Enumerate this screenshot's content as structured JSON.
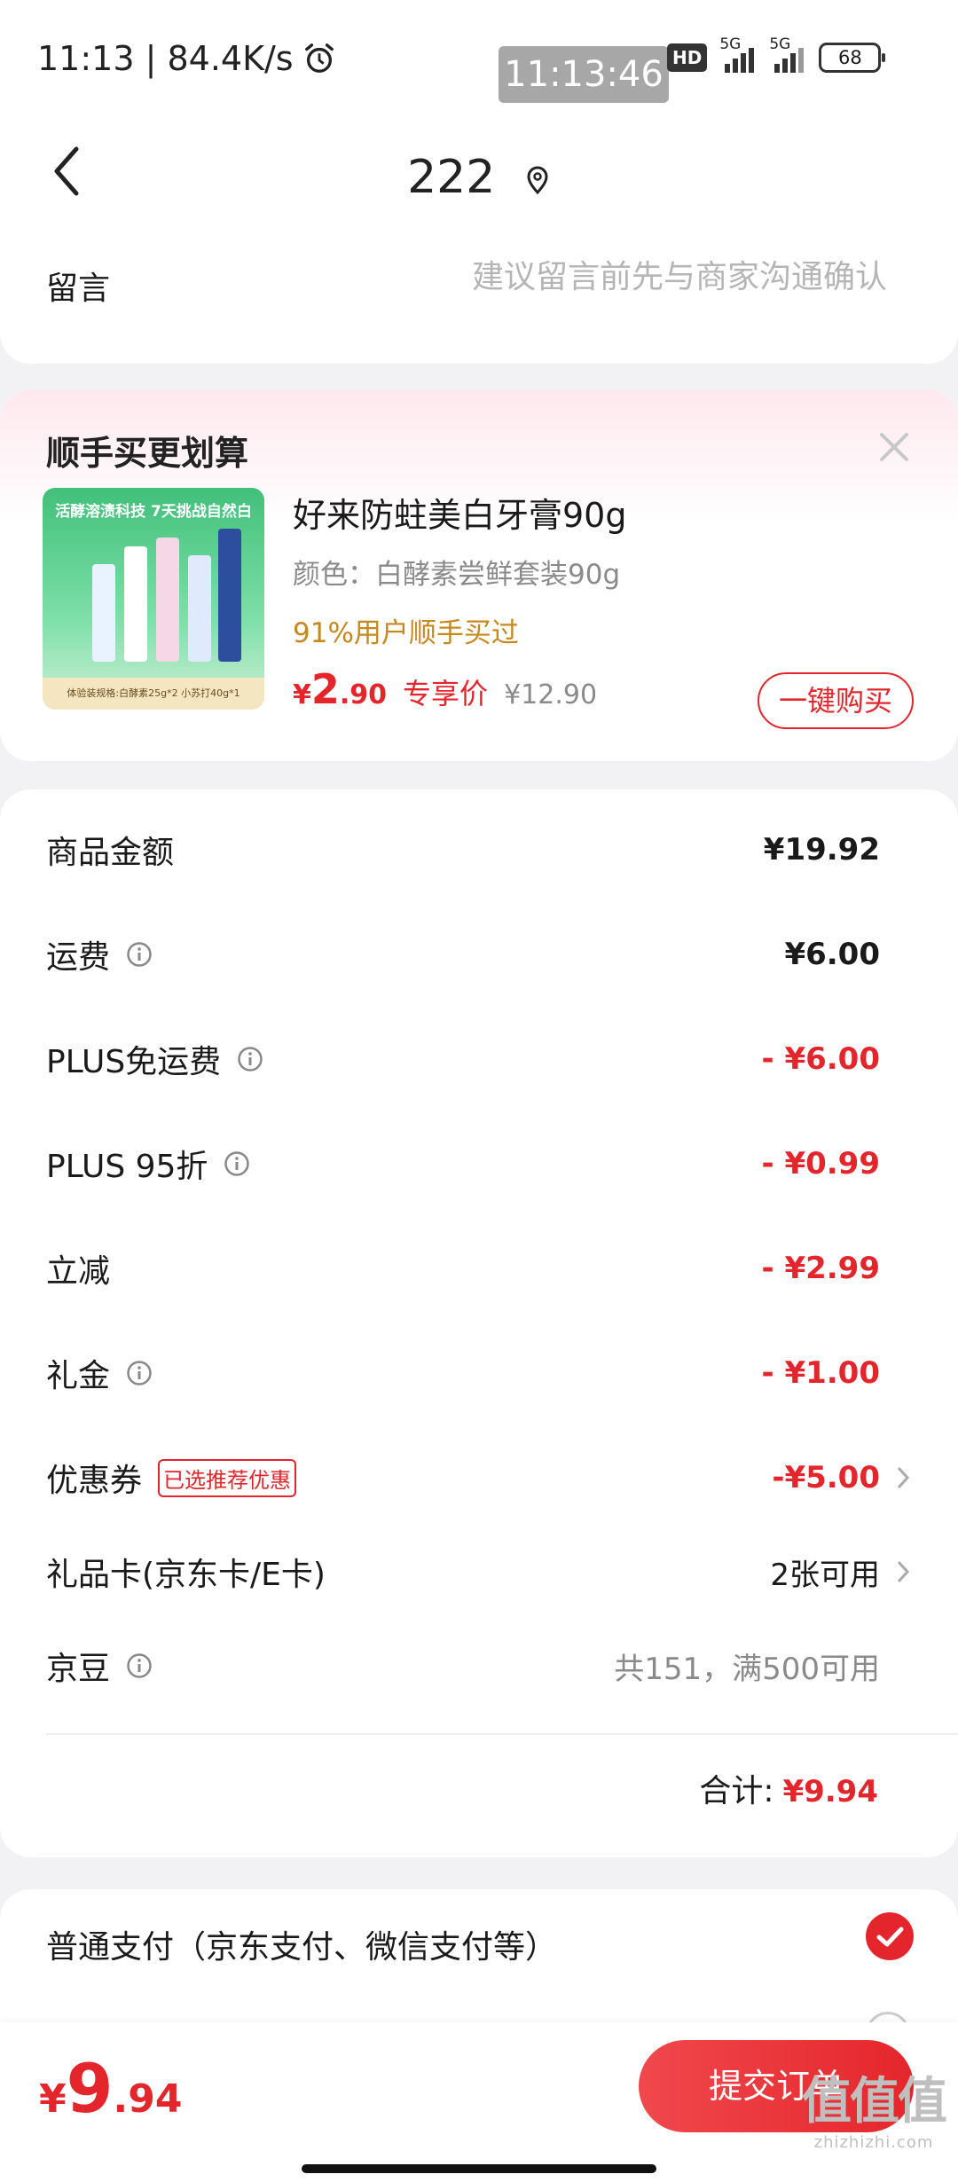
{
  "status_bar": {
    "left_text": "11:13 | 84.4K/s",
    "time_chip": "11:13:46",
    "hd_label": "HD",
    "net1": "5G",
    "net2": "5G",
    "battery": "68"
  },
  "header": {
    "title": "222"
  },
  "message": {
    "label": "留言",
    "placeholder": "建议留言前先与商家沟通确认"
  },
  "promo": {
    "title": "顺手买更划算",
    "image_banner": "活酵溶渍科技 7天挑战自然白",
    "image_footer": "体验装规格:白酵素25g*2 小苏打40g*1",
    "product_name": "好来防蛀美白牙膏90g",
    "spec": "颜色：白酵素尝鲜套装90g",
    "tag": "91%用户顺手买过",
    "price_currency": "¥",
    "price_int": "2",
    "price_dec": ".90",
    "price_label": "专享价",
    "orig_price": "¥12.90",
    "buy_label": "一键购买"
  },
  "summary": {
    "rows": [
      {
        "label": "商品金额",
        "value": "¥19.92"
      },
      {
        "label": "运费",
        "value": "¥6.00"
      },
      {
        "label": "PLUS免运费",
        "value": "- ¥6.00"
      },
      {
        "label": "PLUS 95折",
        "value": "- ¥0.99"
      },
      {
        "label": "立减",
        "value": "- ¥2.99"
      },
      {
        "label": "礼金",
        "value": "- ¥1.00"
      },
      {
        "label": "优惠券",
        "badge": "已选推荐优惠",
        "value": "-¥5.00"
      },
      {
        "label": "礼品卡(京东卡/E卡)",
        "value": "2张可用"
      },
      {
        "label": "京豆",
        "value": "共151，满500可用"
      }
    ],
    "total_label": "合计:",
    "total_value": "¥9.94"
  },
  "payment": {
    "label": "普通支付（京东支付、微信支付等）"
  },
  "bottom": {
    "price_currency": "¥",
    "price_int": "9",
    "price_dec": ".94",
    "submit_label": "提交订单"
  },
  "watermark": {
    "line1": "值值值",
    "line2": "zhizhizhi.com"
  },
  "colors": {
    "accent": "#e4262c",
    "tag": "#c8881c",
    "background": "#f2f2f4"
  }
}
